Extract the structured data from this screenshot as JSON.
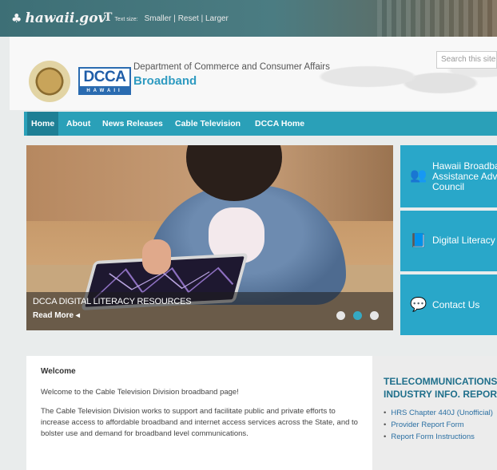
{
  "govbar": {
    "site": "hawaii.gov",
    "text_size_label": "Text size:",
    "smaller": "Smaller",
    "reset": "Reset",
    "larger": "Larger",
    "sep": "|"
  },
  "header": {
    "logo_text": "DCCA",
    "logo_sub": "HAWAII",
    "department": "Department of Commerce and Consumer Affairs",
    "site_name": "Broadband",
    "search_placeholder": "Search this site"
  },
  "nav": {
    "items": [
      "Home",
      "About",
      "News Releases",
      "Cable Television",
      "DCCA Home"
    ]
  },
  "hero": {
    "caption": "DCCA DIGITAL LITERACY RESOURCES",
    "read_more": "Read More ◂",
    "slides": 3,
    "active_slide": 2
  },
  "tiles": [
    {
      "icon": "people-icon",
      "label_lines": [
        "Hawaii Broadband",
        "Assistance Advisory",
        "Council"
      ]
    },
    {
      "icon": "book-icon",
      "label_lines": [
        "Digital Literacy"
      ]
    },
    {
      "icon": "chat-icon",
      "label_lines": [
        "Contact Us"
      ]
    }
  ],
  "welcome": {
    "heading": "Welcome",
    "para1": "Welcome to the Cable Television Division broadband page!",
    "para2": "The Cable Television Division works to support and facilitate public and private efforts to increase access to affordable broadband and internet access services across the State, and to bolster use and demand for broadband level communications."
  },
  "telecom": {
    "heading_line1": "TELECOMMUNICATIONS",
    "heading_line2": "INDUSTRY INFO. REPORT",
    "links": [
      "HRS Chapter 440J (Unofficial)",
      "Provider Report Form",
      "Report Form Instructions"
    ]
  },
  "colors": {
    "nav": "#2aa0b8",
    "tile": "#29a7c9",
    "brand": "#2f9bc1"
  }
}
